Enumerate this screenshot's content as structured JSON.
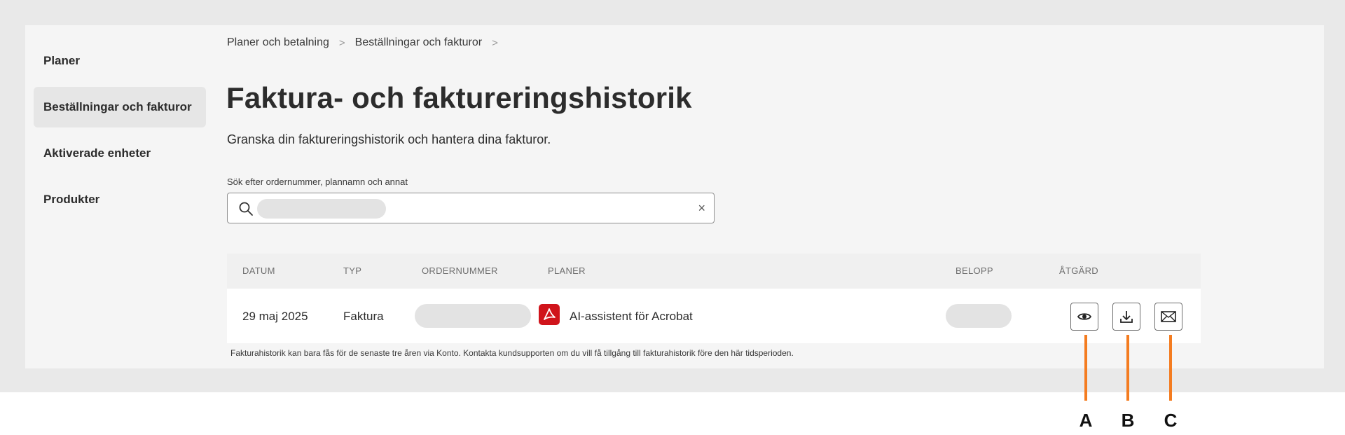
{
  "sidebar": {
    "items": [
      {
        "label": "Planer"
      },
      {
        "label": "Beställningar och fakturor"
      },
      {
        "label": "Aktiverade enheter"
      },
      {
        "label": "Produkter"
      }
    ]
  },
  "breadcrumb": {
    "items": [
      "Planer och betalning",
      "Beställningar och fakturor"
    ],
    "separator": ">"
  },
  "page": {
    "title": "Faktura- och faktureringshistorik",
    "subtitle": "Granska din faktureringshistorik och hantera dina fakturor."
  },
  "search": {
    "label": "Sök efter ordernummer, plannamn och annat",
    "clear_glyph": "×"
  },
  "table": {
    "headers": [
      "DATUM",
      "TYP",
      "ORDERNUMMER",
      "PLANER",
      "BELOPP",
      "ÅTGÄRD"
    ],
    "rows": [
      {
        "date": "29 maj 2025",
        "type": "Faktura",
        "plan": "AI-assistent för Acrobat"
      }
    ]
  },
  "footnote": "Fakturahistorik kan bara fås för de senaste tre åren via Konto. Kontakta kundsupporten om du vill få tillgång till fakturahistorik före den här tidsperioden.",
  "callouts": [
    "A",
    "B",
    "C"
  ],
  "colors": {
    "accent_orange": "#f47c20",
    "acrobat_red": "#d0141b"
  }
}
